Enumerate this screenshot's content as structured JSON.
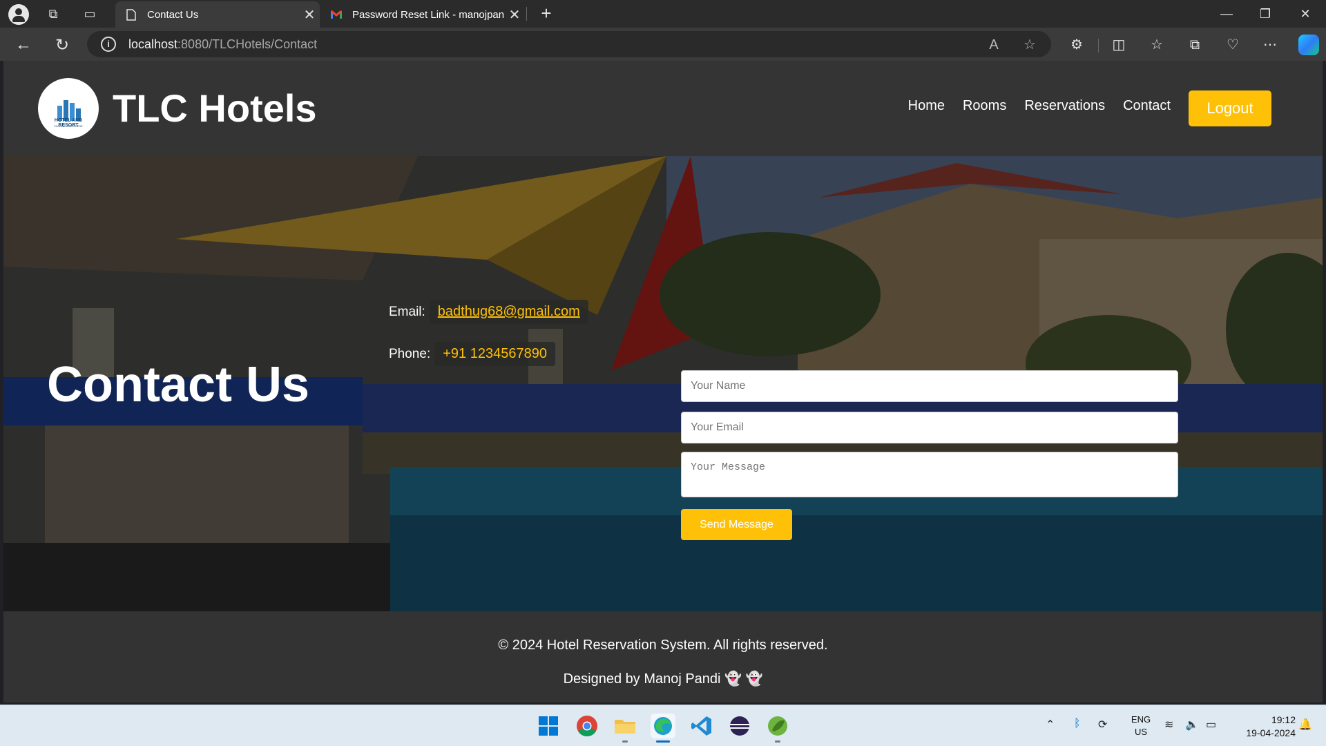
{
  "browser": {
    "tabs": [
      {
        "title": "Contact Us",
        "active": true
      },
      {
        "title": "Password Reset Link - manojpandi",
        "active": false
      }
    ],
    "url_host": "localhost",
    "url_path": ":8080/TLCHotels/Contact"
  },
  "site": {
    "brand": "TLC Hotels",
    "logo_text": "HOTEL AND RESORT",
    "logo_subtext": "TAGLINE GOES HERE",
    "nav": [
      "Home",
      "Rooms",
      "Reservations",
      "Contact"
    ],
    "logout_label": "Logout"
  },
  "contact": {
    "title": "Contact Us",
    "email_label": "Email:",
    "email_value": "badthug68@gmail.com",
    "phone_label": "Phone:",
    "phone_value": "+91 1234567890"
  },
  "form": {
    "name_placeholder": "Your Name",
    "email_placeholder": "Your Email",
    "message_placeholder": "Your Message",
    "send_label": "Send Message"
  },
  "footer": {
    "copyright": "© 2024 Hotel Reservation System. All rights reserved.",
    "credit": "Designed by Manoj Pandi 👻 👻"
  },
  "taskbar": {
    "lang_top": "ENG",
    "lang_bottom": "US",
    "time": "19:12",
    "date": "19-04-2024"
  },
  "colors": {
    "accent": "#ffc107",
    "header_bg": "#343434",
    "chrome_bg": "#2b2b2b"
  }
}
